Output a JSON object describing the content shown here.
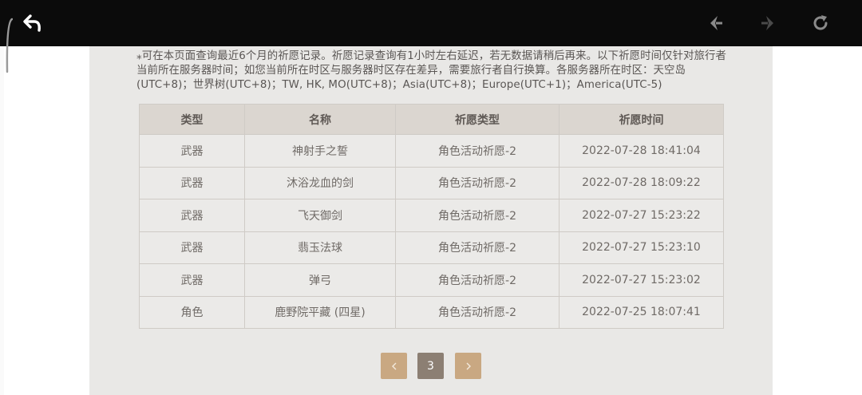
{
  "notice": {
    "text": "⁎可在本页面查询最近6个月的祈愿记录。祈愿记录查询有1小时左右延迟，若无数据请稍后再来。以下祈愿时间仅针对旅行者当前所在服务器时间；如您当前所在时区与服务器时区存在差异，需要旅行者自行换算。各服务器所在时区：天空岛(UTC+8)；世界树(UTC+8)；TW, HK, MO(UTC+8)；Asia(UTC+8)；Europe(UTC+1)；America(UTC-5)"
  },
  "table": {
    "headers": [
      "类型",
      "名称",
      "祈愿类型",
      "祈愿时间"
    ],
    "rows": [
      {
        "type": "武器",
        "name": "神射手之誓",
        "wish": "角色活动祈愿-2",
        "time": "2022-07-28 18:41:04"
      },
      {
        "type": "武器",
        "name": "沐浴龙血的剑",
        "wish": "角色活动祈愿-2",
        "time": "2022-07-28 18:09:22"
      },
      {
        "type": "武器",
        "name": "飞天御剑",
        "wish": "角色活动祈愿-2",
        "time": "2022-07-27 15:23:22"
      },
      {
        "type": "武器",
        "name": "翡玉法球",
        "wish": "角色活动祈愿-2",
        "time": "2022-07-27 15:23:10"
      },
      {
        "type": "武器",
        "name": "弹弓",
        "wish": "角色活动祈愿-2",
        "time": "2022-07-27 15:23:02"
      },
      {
        "type": "角色",
        "name": "鹿野院平藏 (四星)",
        "wish": "角色活动祈愿-2",
        "time": "2022-07-25 18:07:41"
      }
    ]
  },
  "pagination": {
    "prev_icon": "chevron-left-icon",
    "current_page": "3",
    "next_icon": "chevron-right-icon"
  },
  "toolbar": {
    "back_icon": "back-arrow-icon",
    "nav_back_icon": "nav-back-icon",
    "nav_forward_icon": "nav-forward-icon",
    "refresh_icon": "refresh-icon"
  },
  "colors": {
    "toolbar_bg": "#0b0b0b",
    "panel_bg": "#e9e8e6",
    "header_bg": "#dbd6d0",
    "four_star_purple": "#a25bd0",
    "pager_arrow": "#c9a882",
    "pager_current": "#8c7f73"
  }
}
